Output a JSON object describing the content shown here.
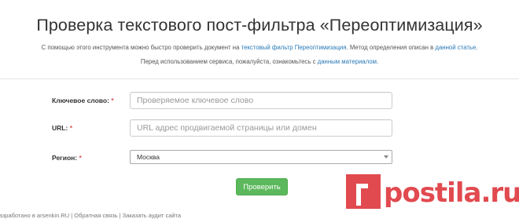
{
  "header": {
    "title": "Проверка текстового пост-фильтра «Переоптимизация»",
    "desc1_before": "С помощью этого инструмента можно быстро проверить документ на ",
    "desc1_link1": "текстовый фильтр Переоптимизация",
    "desc1_middle": ". Метод определения описан в ",
    "desc1_link2": "данной статье",
    "desc1_after": ".",
    "desc2_before": "Перед использованием сервиса, пожалуйста, ознакомьтесь с ",
    "desc2_link": "данным материалом",
    "desc2_after": "."
  },
  "form": {
    "keyword_label": "Ключевое слово:",
    "keyword_placeholder": "Проверяемое ключевое слово",
    "url_label": "URL:",
    "url_placeholder": "URL адрес продвигаемой страницы или домен",
    "region_label": "Регион:",
    "region_value": "Москва",
    "required_mark": "*",
    "submit_label": "Проверить"
  },
  "footer": {
    "text": "Разработано в arsenkin.RU | Обратная связь | Заказать аудит сайта"
  },
  "watermark": {
    "text": "postila.ru"
  },
  "colors": {
    "link": "#2a7ab7",
    "button": "#5cb85c",
    "required": "#d9534f",
    "watermark": "#e14a4f"
  }
}
